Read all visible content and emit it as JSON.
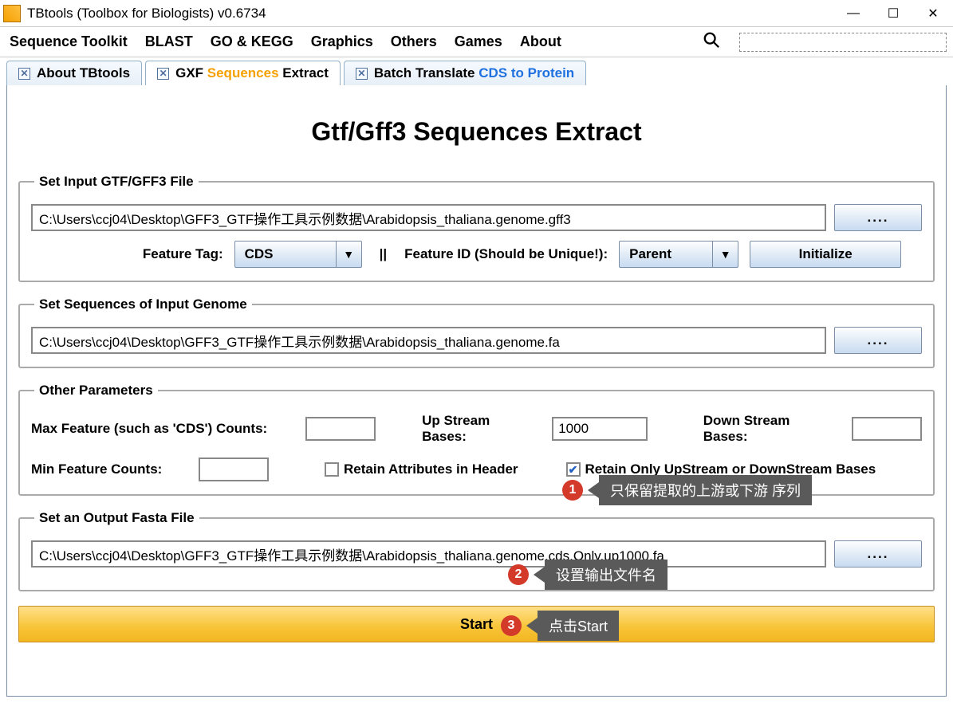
{
  "window": {
    "title": "TBtools (Toolbox for Biologists) v0.6734"
  },
  "menu": {
    "items": [
      "Sequence Toolkit",
      "BLAST",
      "GO & KEGG",
      "Graphics",
      "Others",
      "Games",
      "About"
    ]
  },
  "tabs": [
    {
      "label_parts": [
        "About TBtools"
      ],
      "active": false
    },
    {
      "label_parts": [
        "GXF ",
        "Sequences",
        " Extract"
      ],
      "orange_idx": 1,
      "active": true
    },
    {
      "label_parts": [
        "Batch Translate ",
        "CDS to Protein"
      ],
      "blue_idx": 1,
      "active": false
    }
  ],
  "page": {
    "title": "Gtf/Gff3 Sequences Extract"
  },
  "input_gff": {
    "legend": "Set Input GTF/GFF3 File",
    "path": "C:\\Users\\ccj04\\Desktop\\GFF3_GTF操作工具示例数据\\Arabidopsis_thaliana.genome.gff3",
    "browse": "....",
    "feature_tag_label": "Feature Tag:",
    "feature_tag_value": "CDS",
    "pipe": "||",
    "feature_id_label": "Feature ID (Should be Unique!):",
    "feature_id_value": "Parent",
    "initialize": "Initialize"
  },
  "input_genome": {
    "legend": "Set Sequences of Input Genome",
    "path": "C:\\Users\\ccj04\\Desktop\\GFF3_GTF操作工具示例数据\\Arabidopsis_thaliana.genome.fa",
    "browse": "...."
  },
  "other_params": {
    "legend": "Other Parameters",
    "max_label": "Max Feature (such as 'CDS') Counts:",
    "max_value": "",
    "up_label": "Up Stream Bases:",
    "up_value": "1000",
    "down_label": "Down Stream Bases:",
    "down_value": "",
    "min_label": "Min Feature Counts:",
    "min_value": "",
    "retain_attr_label": "Retain Attributes in Header",
    "retain_attr_checked": false,
    "retain_only_label": "Retain Only UpStream or DownStream Bases",
    "retain_only_checked": true
  },
  "output": {
    "legend": "Set an Output Fasta File",
    "path": "C:\\Users\\ccj04\\Desktop\\GFF3_GTF操作工具示例数据\\Arabidopsis_thaliana.genome.cds.Only.up1000.fa",
    "browse": "...."
  },
  "start": {
    "label": "Start"
  },
  "annotations": [
    {
      "n": "1",
      "text": "只保留提取的上游或下游 序列"
    },
    {
      "n": "2",
      "text": "设置输出文件名"
    },
    {
      "n": "3",
      "text": "点击Start"
    }
  ]
}
